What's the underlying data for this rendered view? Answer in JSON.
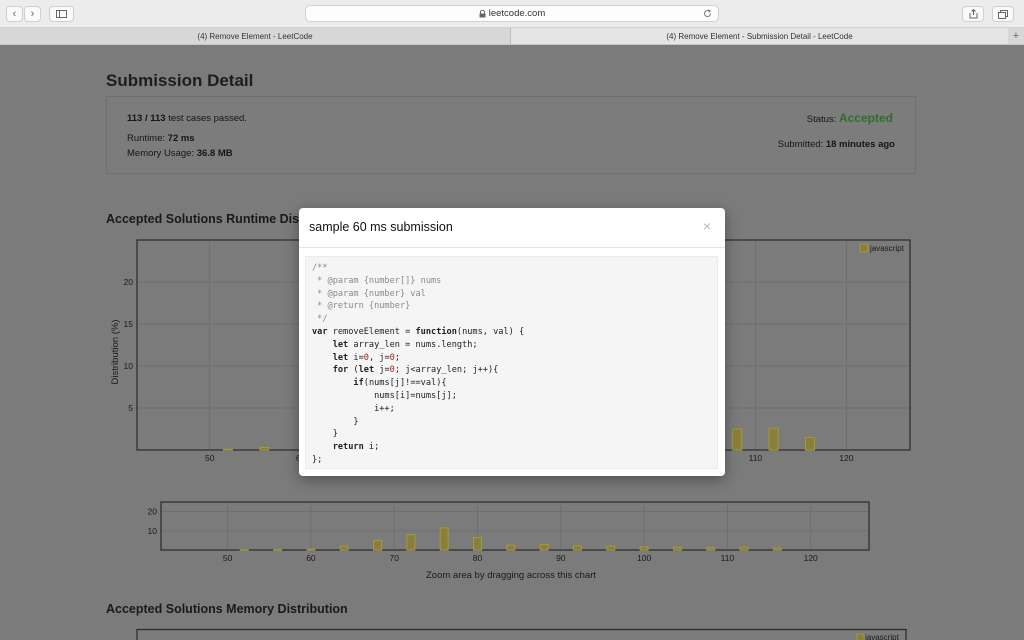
{
  "browser": {
    "url": "leetcode.com",
    "tabs": [
      {
        "title": "(4) Remove Element - LeetCode",
        "active": false
      },
      {
        "title": "(4) Remove Element - Submission Detail - LeetCode",
        "active": true
      }
    ],
    "new_tab_label": "+"
  },
  "page": {
    "title": "Submission Detail",
    "summary": {
      "tests_passed": "113 / 113",
      "tests_text": "test cases passed.",
      "status_label": "Status:",
      "status_value": "Accepted",
      "runtime_label": "Runtime:",
      "runtime_value": "72 ms",
      "memory_label": "Memory Usage:",
      "memory_value": "36.8 MB",
      "submitted_label": "Submitted:",
      "submitted_value": "18 minutes ago"
    },
    "runtime_section_title": "Accepted Solutions Runtime Distribution",
    "memory_section_title": "Accepted Solutions Memory Distribution",
    "zoom_hint": "Zoom area by dragging across this chart",
    "memory_legend": "javascript"
  },
  "chart_data": [
    {
      "type": "bar",
      "ylabel": "Distribution (%)",
      "legend": [
        "javascript"
      ],
      "legend_position": "top-right",
      "xlim": [
        42,
        127
      ],
      "ylim": [
        0,
        25
      ],
      "xticks": [
        50,
        60,
        70,
        80,
        90,
        100,
        110,
        120
      ],
      "yticks": [
        5,
        10,
        15,
        20
      ],
      "grid": true,
      "x": [
        52,
        56,
        108,
        112,
        116
      ],
      "values": [
        0.1,
        0.3,
        2.5,
        2.6,
        1.5
      ]
    },
    {
      "type": "bar",
      "xlabel": "Zoom area by dragging across this chart",
      "xlim": [
        42,
        127
      ],
      "ylim": [
        0,
        25
      ],
      "xticks": [
        50,
        60,
        70,
        80,
        90,
        100,
        110,
        120
      ],
      "yticks": [
        10,
        20
      ],
      "grid": true,
      "x": [
        52,
        56,
        60,
        64,
        68,
        72,
        76,
        80,
        84,
        88,
        92,
        96,
        100,
        104,
        108,
        112,
        116
      ],
      "values": [
        0.1,
        0.2,
        0.5,
        2.0,
        5.0,
        8.0,
        11.5,
        6.5,
        2.5,
        2.8,
        2.2,
        2.0,
        1.6,
        1.4,
        1.2,
        1.5,
        1.0
      ]
    }
  ],
  "modal": {
    "title": "sample 60 ms submission",
    "close_label": "×"
  },
  "colors": {
    "accepted": "#2f6d2f",
    "bar_fill": "#8a7f3a",
    "bar_stroke": "#a39a3c",
    "overlay": "#7b7b7b"
  }
}
